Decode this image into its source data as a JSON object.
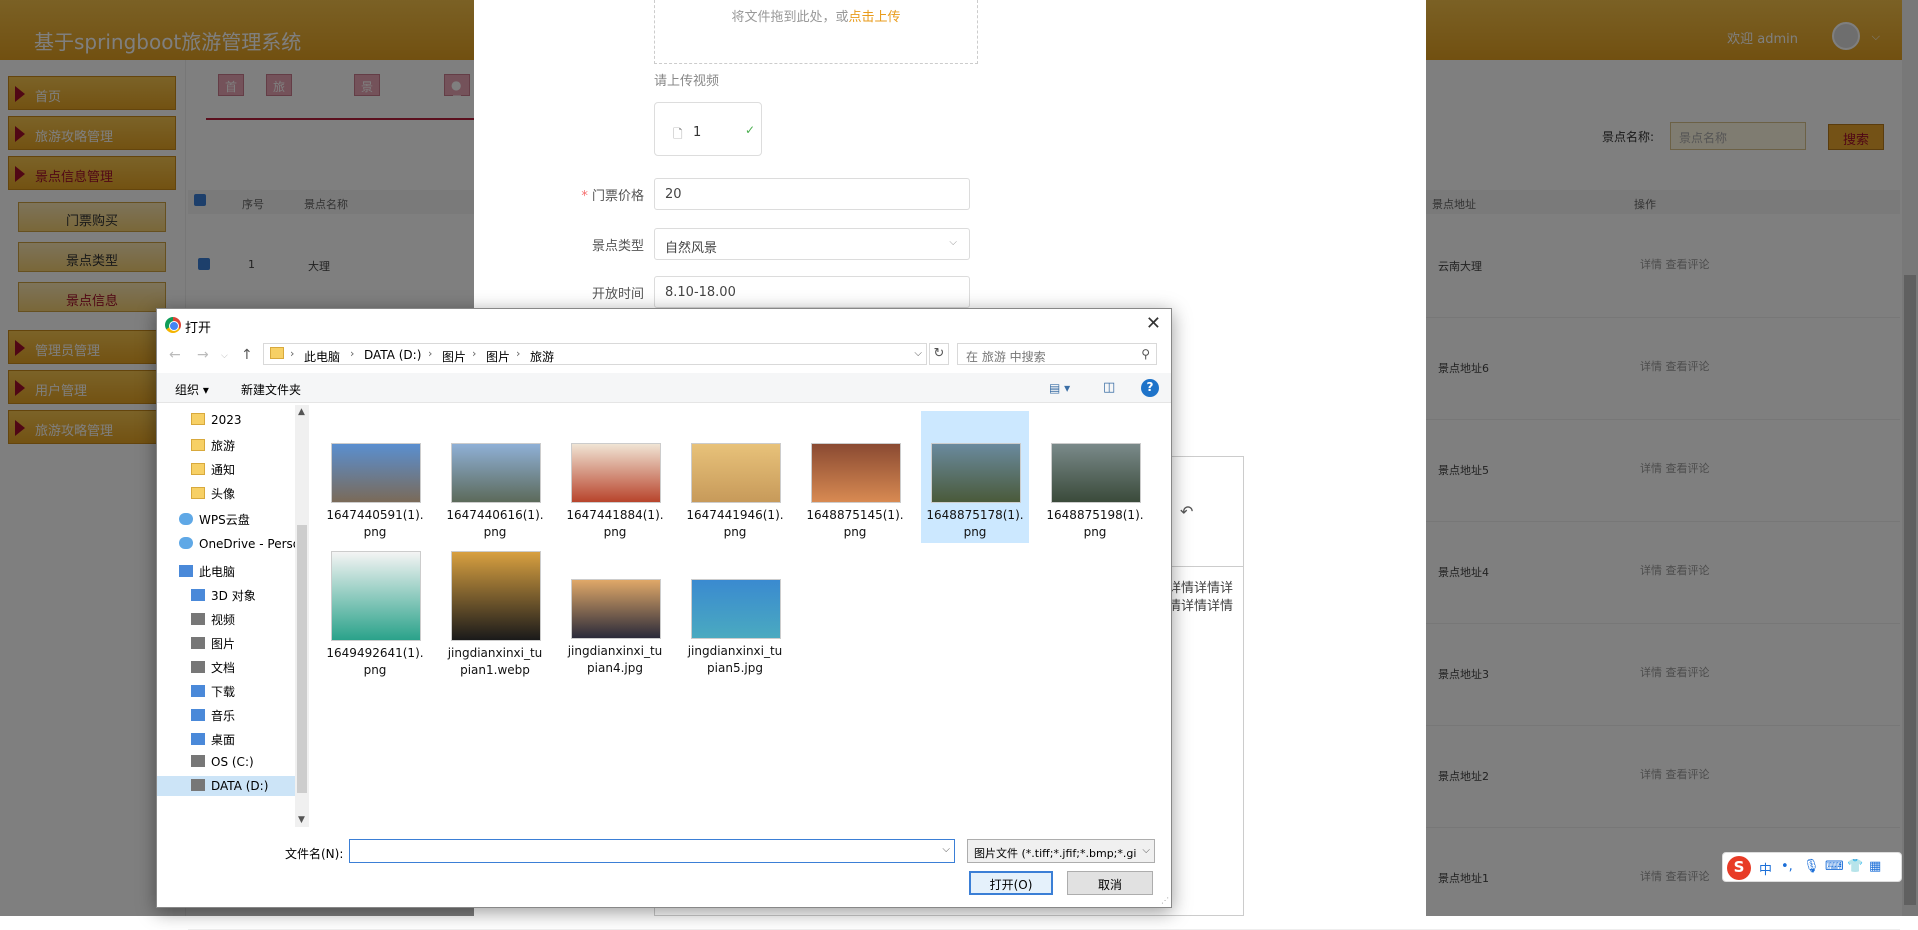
{
  "app": {
    "title": "基于springboot旅游管理系统",
    "welcome": "欢迎 admin",
    "sidebar": [
      {
        "label": "首页",
        "active": false
      },
      {
        "label": "旅游攻略管理",
        "active": false
      },
      {
        "label": "景点信息管理",
        "active": true
      },
      {
        "label": "管理员管理",
        "active": false
      },
      {
        "label": "用户管理",
        "active": false
      },
      {
        "label": "旅游攻略管理",
        "active": false
      }
    ],
    "submenu": [
      {
        "label": "门票购买",
        "active": false
      },
      {
        "label": "景点类型",
        "active": false
      },
      {
        "label": "景点信息",
        "active": true
      }
    ],
    "tabs": [
      "首页",
      "旅游攻略",
      "景点类型",
      "●景"
    ],
    "search": {
      "label": "景点名称:",
      "placeholder": "景点名称",
      "button": "搜索"
    },
    "table": {
      "headers": [
        "序号",
        "景点名称",
        "景点地址",
        "操作"
      ],
      "rows": [
        {
          "index": "1",
          "name": "大理",
          "address": "云南大理",
          "ops": "详情  查看评论"
        },
        {
          "index": "",
          "name": "",
          "address": "景点地址6",
          "ops": "详情  查看评论"
        },
        {
          "index": "",
          "name": "",
          "address": "景点地址5",
          "ops": "详情  查看评论"
        },
        {
          "index": "",
          "name": "",
          "address": "景点地址4",
          "ops": "详情  查看评论"
        },
        {
          "index": "",
          "name": "",
          "address": "景点地址3",
          "ops": "详情  查看评论"
        },
        {
          "index": "",
          "name": "",
          "address": "景点地址2",
          "ops": "详情  查看评论"
        },
        {
          "index": "",
          "name": "",
          "address": "景点地址1",
          "ops": "详情  查看评论"
        }
      ]
    }
  },
  "form": {
    "upload_hint": "将文件拖到此处，或",
    "upload_link": "点击上传",
    "video_label": "请上传视频",
    "video_file": "1",
    "price_label": "门票价格",
    "price_value": "20",
    "type_label": "景点类型",
    "type_value": "自然风景",
    "open_label": "开放时间",
    "open_value": "8.10-18.00",
    "detail_text": "详情详情详情详情详情"
  },
  "dialog": {
    "title": "打开",
    "breadcrumb": [
      "此电脑",
      "DATA (D:)",
      "图片",
      "图片",
      "旅游"
    ],
    "search_placeholder": "在 旅游 中搜索",
    "organize": "组织 ▾",
    "new_folder": "新建文件夹",
    "tree": [
      {
        "label": "2023",
        "icon": "folder-icon"
      },
      {
        "label": "旅游",
        "icon": "folder-icon"
      },
      {
        "label": "通知",
        "icon": "folder-icon"
      },
      {
        "label": "头像",
        "icon": "folder-icon"
      },
      {
        "label": "WPS云盘",
        "icon": "cloud-icon"
      },
      {
        "label": "OneDrive - Perso",
        "icon": "cloud-icon"
      },
      {
        "label": "此电脑",
        "icon": "computer-icon"
      },
      {
        "label": "3D 对象",
        "icon": "cube-icon"
      },
      {
        "label": "视频",
        "icon": "video-icon"
      },
      {
        "label": "图片",
        "icon": "picture-icon"
      },
      {
        "label": "文档",
        "icon": "document-icon"
      },
      {
        "label": "下载",
        "icon": "download-icon"
      },
      {
        "label": "音乐",
        "icon": "music-icon"
      },
      {
        "label": "桌面",
        "icon": "desktop-icon"
      },
      {
        "label": "OS (C:)",
        "icon": "drive-icon"
      },
      {
        "label": "DATA (D:)",
        "icon": "drive-icon"
      }
    ],
    "files": [
      {
        "line1": "1647440591(1).",
        "line2": "png",
        "colors": [
          "#5a8fd0",
          "#7a6a58"
        ]
      },
      {
        "line1": "1647440616(1).",
        "line2": "png",
        "colors": [
          "#8fb0d6",
          "#5c6a5a"
        ]
      },
      {
        "line1": "1647441884(1).",
        "line2": "png",
        "colors": [
          "#f0e4d4",
          "#b8442c"
        ]
      },
      {
        "line1": "1647441946(1).",
        "line2": "png",
        "colors": [
          "#e8c27a",
          "#c79a5a"
        ]
      },
      {
        "line1": "1648875145(1).",
        "line2": "png",
        "colors": [
          "#8a4a32",
          "#d88a52"
        ]
      },
      {
        "line1": "1648875178(1).",
        "line2": "png",
        "colors": [
          "#6a8a9e",
          "#4a5a3a"
        ]
      },
      {
        "line1": "1648875198(1).",
        "line2": "png",
        "colors": [
          "#7a8a8a",
          "#3a4a3a"
        ]
      },
      {
        "line1": "1649492641(1).",
        "line2": "png",
        "colors": [
          "#f4f4f4",
          "#2aa28a"
        ]
      },
      {
        "line1": "jingdianxinxi_tu",
        "line2": "pian1.webp",
        "colors": [
          "#d8a040",
          "#1a1a1a"
        ]
      },
      {
        "line1": "jingdianxinxi_tu",
        "line2": "pian4.jpg",
        "colors": [
          "#e0a868",
          "#2a2a3a"
        ]
      },
      {
        "line1": "jingdianxinxi_tu",
        "line2": "pian5.jpg",
        "colors": [
          "#3a8ad0",
          "#4aaac0"
        ]
      }
    ],
    "filename_label": "文件名(N):",
    "filename_value": "",
    "filetype": "图片文件 (*.tiff;*.jfif;*.bmp;*.gi",
    "open_button": "打开(O)",
    "cancel_button": "取消"
  },
  "ime": {
    "lang": "中"
  }
}
